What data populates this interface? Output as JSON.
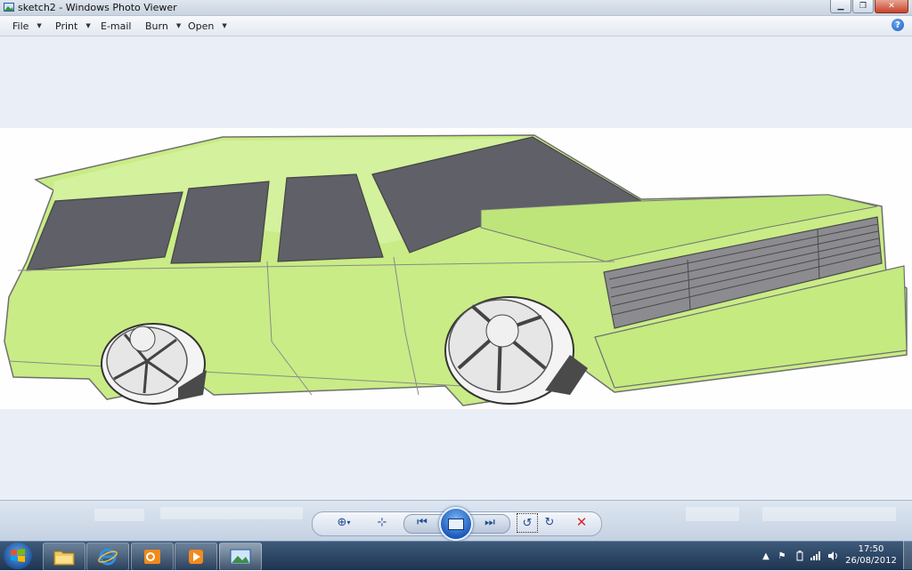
{
  "window": {
    "title": "sketch2 - Windows Photo Viewer",
    "controls": {
      "minimize": "▁",
      "maximize": "❐",
      "close": "✕"
    }
  },
  "menu": {
    "items": [
      {
        "label": "File",
        "has_dropdown": true
      },
      {
        "label": "Print",
        "has_dropdown": true
      },
      {
        "label": "E-mail",
        "has_dropdown": false
      },
      {
        "label": "Burn",
        "has_dropdown": true
      },
      {
        "label": "Open",
        "has_dropdown": true
      }
    ],
    "caret": "▼",
    "help": "?"
  },
  "photo": {
    "subject": "pencil sketch of a lowered green station wagon",
    "colors": {
      "body": "#c9ec86",
      "glass": "#5f6068",
      "outline": "#6f6f6f"
    }
  },
  "controls": {
    "zoom": "⊕",
    "zoom_caret": "▾",
    "actual_size": "⊹",
    "previous": "⏮",
    "next": "⏭",
    "rotate_ccw": "↺",
    "rotate_cw": "↻",
    "delete": "✕"
  },
  "taskbar": {
    "apps": [
      "file-explorer",
      "internet-explorer",
      "outlook",
      "media-player",
      "photo-viewer"
    ],
    "tray": {
      "up_arrow": "▲",
      "flag": "⚑",
      "volume": "🔊"
    },
    "clock": {
      "time": "17:50",
      "date": "26/08/2012"
    }
  },
  "colors": {
    "accent": "#1d5bbd",
    "delete_red": "#d62b2b",
    "taskbar": "#2b4566"
  }
}
